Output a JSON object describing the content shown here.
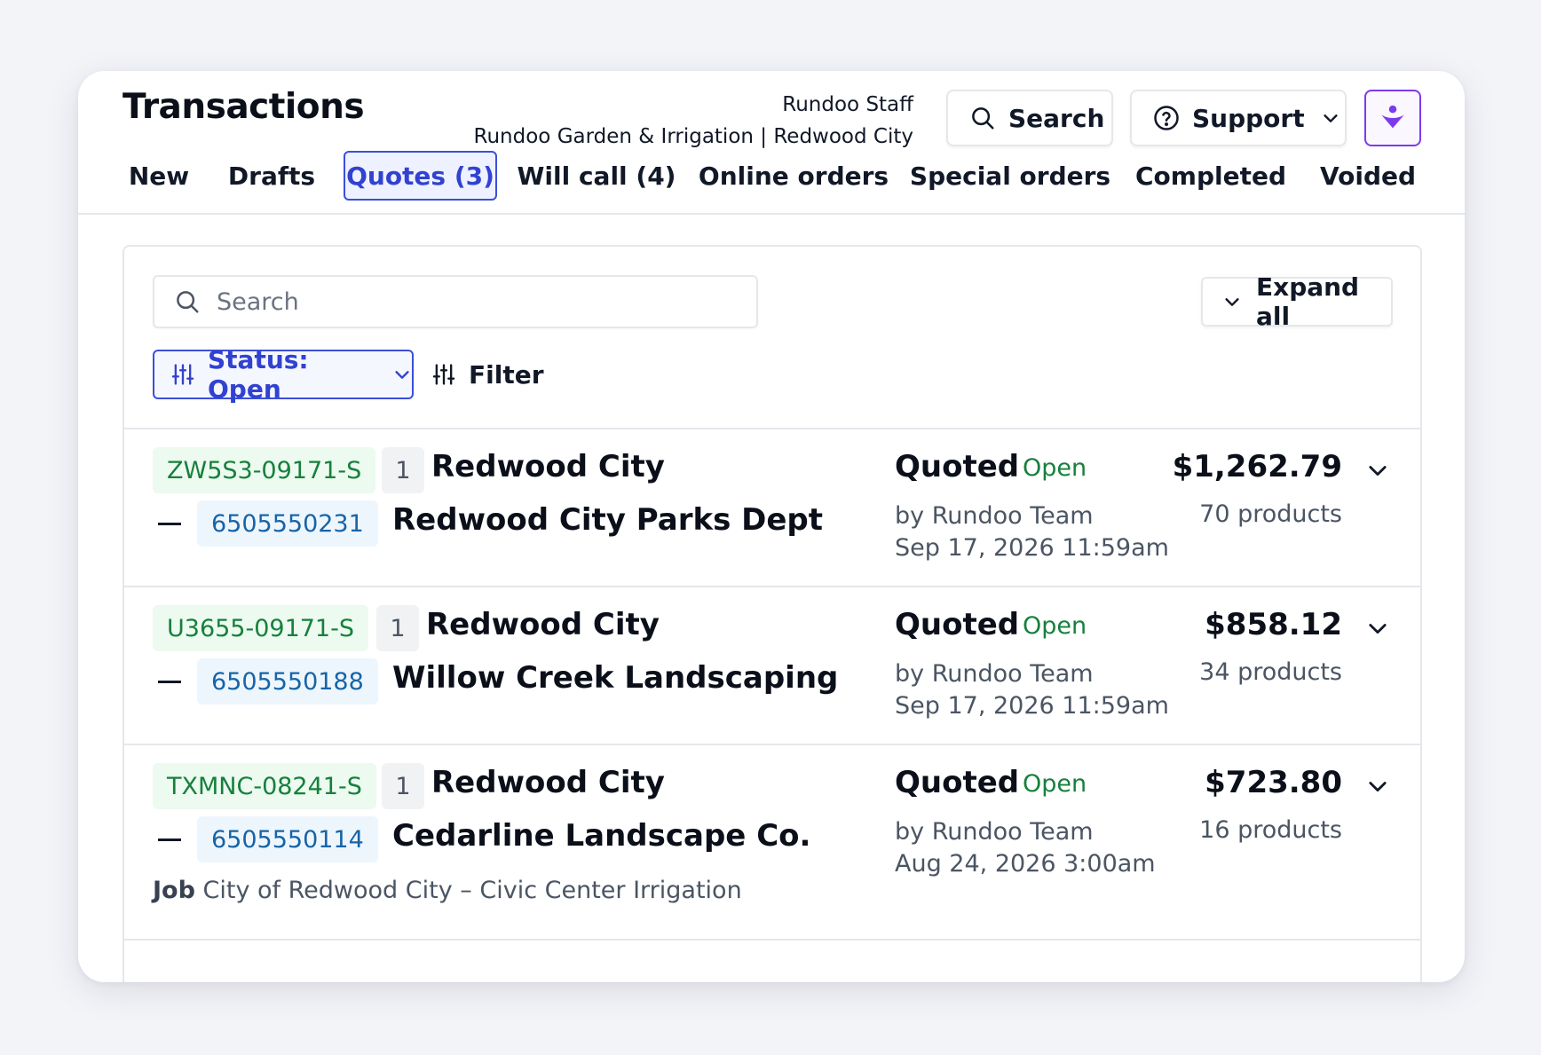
{
  "header": {
    "title": "Transactions",
    "staff_role": "Rundoo Staff",
    "store": "Rundoo Garden & Irrigation | Redwood City",
    "search_label": "Search",
    "support_label": "Support"
  },
  "tabs": [
    {
      "label": "New"
    },
    {
      "label": "Drafts"
    },
    {
      "label": "Quotes (3)",
      "active": true
    },
    {
      "label": "Will call (4)"
    },
    {
      "label": "Online orders"
    },
    {
      "label": "Special orders"
    },
    {
      "label": "Completed"
    },
    {
      "label": "Voided"
    }
  ],
  "toolbar": {
    "search_placeholder": "Search",
    "expand_label": "Expand all",
    "status_filter_label": "Status: Open",
    "filter_label": "Filter"
  },
  "transactions": [
    {
      "id": "ZW5S3-09171-S",
      "qty": "1",
      "location": "Redwood City",
      "phone": "6505550231",
      "customer": "Redwood City Parks Dept",
      "status": "Quoted",
      "badge": "Open",
      "by": "by Rundoo Team",
      "date": "Sep 17, 2026 11:59am",
      "amount": "$1,262.79",
      "products": "70 products"
    },
    {
      "id": "U3655-09171-S",
      "qty": "1",
      "location": "Redwood City",
      "phone": "6505550188",
      "customer": "Willow Creek Landscaping",
      "status": "Quoted",
      "badge": "Open",
      "by": "by Rundoo Team",
      "date": "Sep 17, 2026 11:59am",
      "amount": "$858.12",
      "products": "34 products"
    },
    {
      "id": "TXMNC-08241-S",
      "qty": "1",
      "location": "Redwood City",
      "phone": "6505550114",
      "customer": "Cedarline Landscape Co.",
      "job_label": "Job",
      "job": "City of Redwood City – Civic Center Irrigation",
      "status": "Quoted",
      "badge": "Open",
      "by": "by Rundoo Team",
      "date": "Aug 24, 2026 3:00am",
      "amount": "$723.80",
      "products": "16 products"
    }
  ],
  "colors": {
    "accent": "#3b4fd8",
    "brand": "#7c3aed",
    "open_green": "#16803c",
    "phone_blue": "#1764a8"
  }
}
